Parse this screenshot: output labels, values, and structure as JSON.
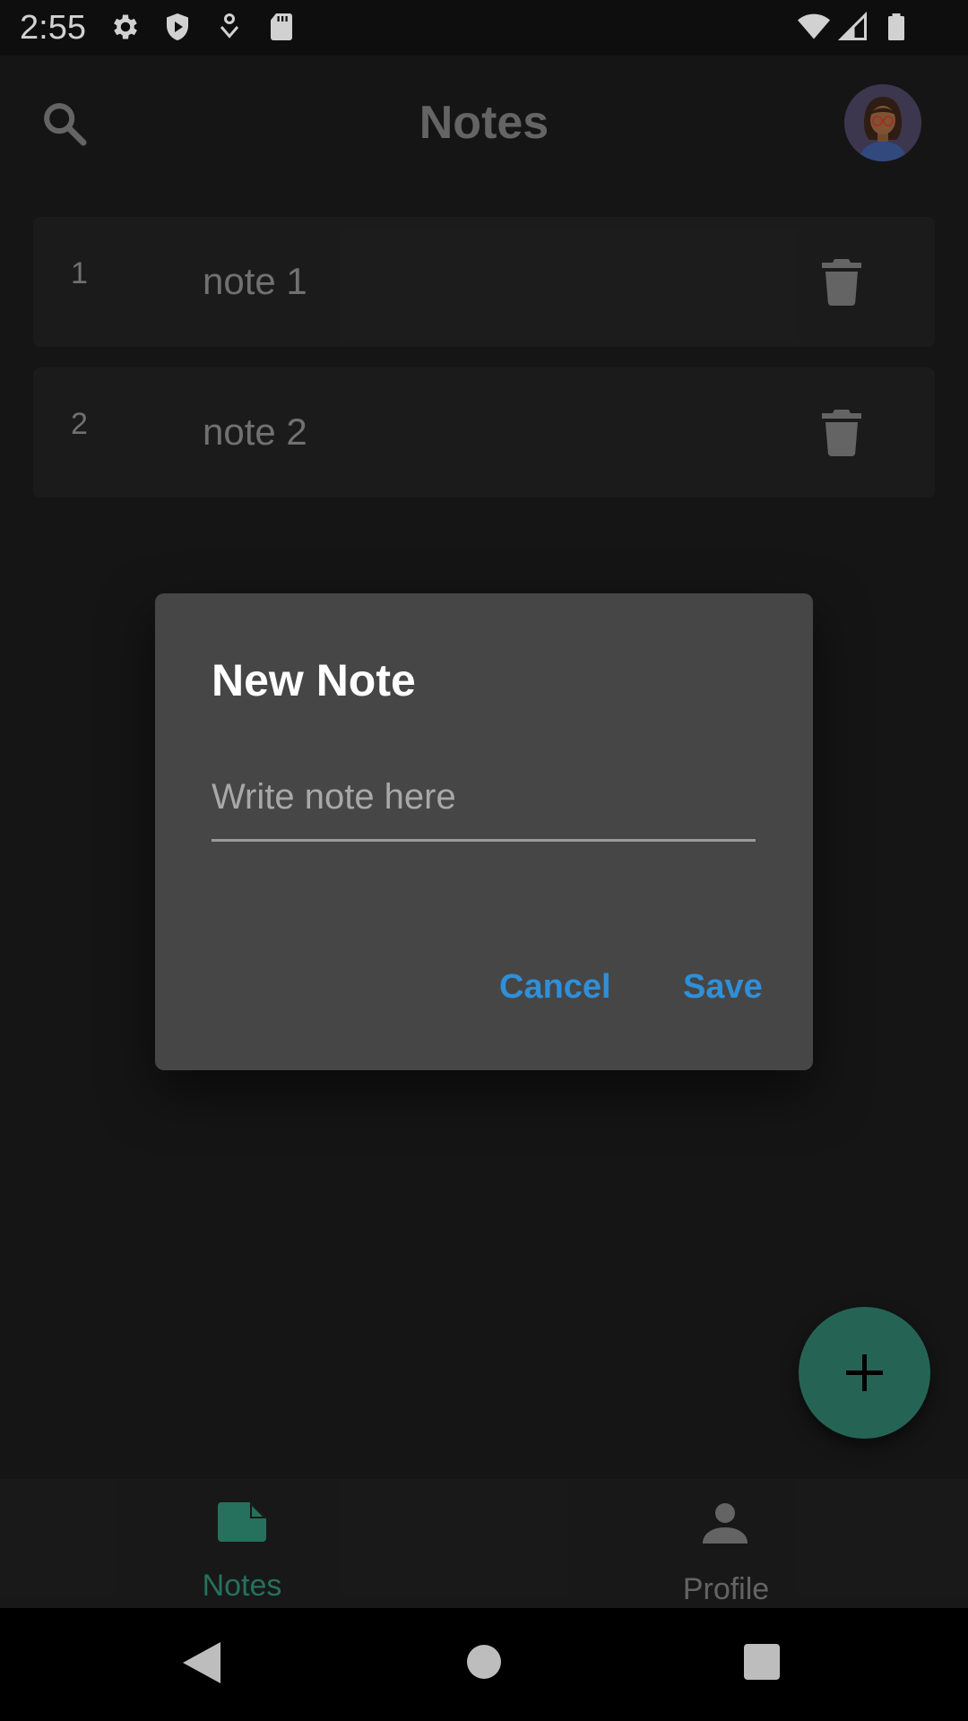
{
  "status": {
    "time": "2:55"
  },
  "appbar": {
    "title": "Notes"
  },
  "notes": [
    {
      "number": "1",
      "text": "note 1"
    },
    {
      "number": "2",
      "text": "note 2"
    }
  ],
  "dialog": {
    "title": "New Note",
    "input_placeholder": "Write note here",
    "input_value": "",
    "cancel_label": "Cancel",
    "save_label": "Save"
  },
  "fab": {
    "label": "+"
  },
  "bottom_nav": {
    "items": [
      {
        "label": "Notes",
        "active": true
      },
      {
        "label": "Profile",
        "active": false
      }
    ]
  },
  "colors": {
    "accent": "#2e7a68",
    "active_nav": "#2e8a72",
    "dialog_button": "#2f8fd8",
    "dialog_bg": "#464646",
    "background": "#1a1a1a"
  }
}
